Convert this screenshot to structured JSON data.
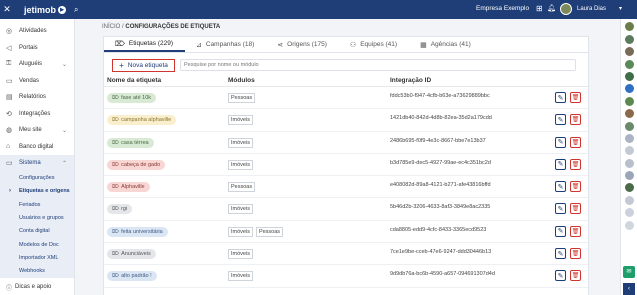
{
  "topbar": {
    "close_icon": "close-icon",
    "logo": "jetimob",
    "company": "Empresa Exemplo",
    "user_name": "Laura Dias"
  },
  "sidebar": {
    "items": [
      {
        "label": "Atividades",
        "icon": "check-icon"
      },
      {
        "label": "Portais",
        "icon": "megaphone-icon"
      },
      {
        "label": "Aluguéis",
        "icon": "key-icon",
        "expand": "⌄"
      },
      {
        "label": "Vendas",
        "icon": "cash-icon"
      },
      {
        "label": "Relatórios",
        "icon": "report-icon"
      },
      {
        "label": "Integrações",
        "icon": "plug-icon"
      },
      {
        "label": "Meu site",
        "icon": "globe-icon",
        "expand": "⌄"
      },
      {
        "label": "Banco digital",
        "icon": "bank-icon"
      },
      {
        "label": "Sistema",
        "icon": "monitor-icon",
        "expand": "⌃"
      }
    ],
    "subitems": [
      {
        "label": "Configurações"
      },
      {
        "label": "Etiquetas e origens"
      },
      {
        "label": "Feriados"
      },
      {
        "label": "Usuários e grupos"
      },
      {
        "label": "Conta digital"
      },
      {
        "label": "Modelos de Doc"
      },
      {
        "label": "Importador XML"
      },
      {
        "label": "Webhooks"
      }
    ],
    "bottom": "Dicas e apoio"
  },
  "breadcrumb": {
    "home": "INÍCIO",
    "sep": "/",
    "current": "CONFIGURAÇÕES DE ETIQUETA"
  },
  "tabs": [
    {
      "label": "Etiquetas (229)",
      "icon": "tag-icon"
    },
    {
      "label": "Campanhas (18)",
      "icon": "chart-icon"
    },
    {
      "label": "Origens (175)",
      "icon": "share-icon"
    },
    {
      "label": "Equipes (41)",
      "icon": "team-icon"
    },
    {
      "label": "Agências (41)",
      "icon": "building-icon"
    }
  ],
  "toolbar": {
    "new_label": "Nova etiqueta",
    "search_placeholder": "Pesquise por nome ou módulo"
  },
  "table": {
    "headers": {
      "name": "Nome da etiqueta",
      "modules": "Módulos",
      "id": "Integração ID"
    },
    "rows": [
      {
        "name": "fase até 10k",
        "bg": "#d8ead4",
        "fg": "#4a6b44",
        "modules": [
          "Pessoas"
        ],
        "id": "fddc53b0-f947-4cfb-b63e-a73629889bbc"
      },
      {
        "name": "campanha alphaville",
        "bg": "#faefcc",
        "fg": "#8a7432",
        "modules": [
          "Imóveis"
        ],
        "id": "1421db40-842d-4d8b-82ea-35d2a179cdd"
      },
      {
        "name": "casa térrea",
        "bg": "#d8ead4",
        "fg": "#4a6b44",
        "modules": [
          "Imóveis"
        ],
        "id": "2486b695-f0f9-4e3c-8667-bbe7e13b37"
      },
      {
        "name": "cabeça de gado",
        "bg": "#f8d6d3",
        "fg": "#8a3b35",
        "modules": [
          "Imóveis"
        ],
        "id": "b3d785e9-dec5-4927-99ae-ec4c351bc2d"
      },
      {
        "name": "Alphaville",
        "bg": "#f8d6d3",
        "fg": "#8a3b35",
        "modules": [
          "Pessoas"
        ],
        "id": "e408082d-89a8-4121-b271-afe43816bffd"
      },
      {
        "name": "rgi",
        "bg": "#e4e6ea",
        "fg": "#555555",
        "modules": [
          "Imóveis"
        ],
        "id": "5b46d2b-3206-4633-8af3-3849e8ac2335"
      },
      {
        "name": "feita universitária",
        "bg": "#dbe6f4",
        "fg": "#3e5a82",
        "modules": [
          "Imóveis",
          "Pessoas"
        ],
        "id": "cda8805-edd9-4cfc-8433-3365ecd9523"
      },
      {
        "name": "Anunciáveis",
        "bg": "#e4e6ea",
        "fg": "#555555",
        "modules": [
          "Imóveis"
        ],
        "id": "7ce1e9be-cceb-47e6-9247-ddd30446b13"
      },
      {
        "name": "alto padrão !",
        "bg": "#dbe6f4",
        "fg": "#3e5a82",
        "modules": [
          "Imóveis"
        ],
        "id": "9d9db76a-bc6b-4590-a657-094691307d4d"
      }
    ]
  },
  "rail": {
    "avatars": [
      "#6b7d4a",
      "#5b7a5e",
      "#7a6a58",
      "#5a8a5a",
      "#3e6e4a",
      "#2f6fc4",
      "#5c8a4e",
      "#8a6a4a",
      "#6a8a6a",
      "#aab4c4",
      "#c4cad4",
      "#b8c0cc",
      "#9aa6b8",
      "#4a6a4a",
      "#c4cad4",
      "#ccd2dc",
      "#d0d6de"
    ]
  }
}
